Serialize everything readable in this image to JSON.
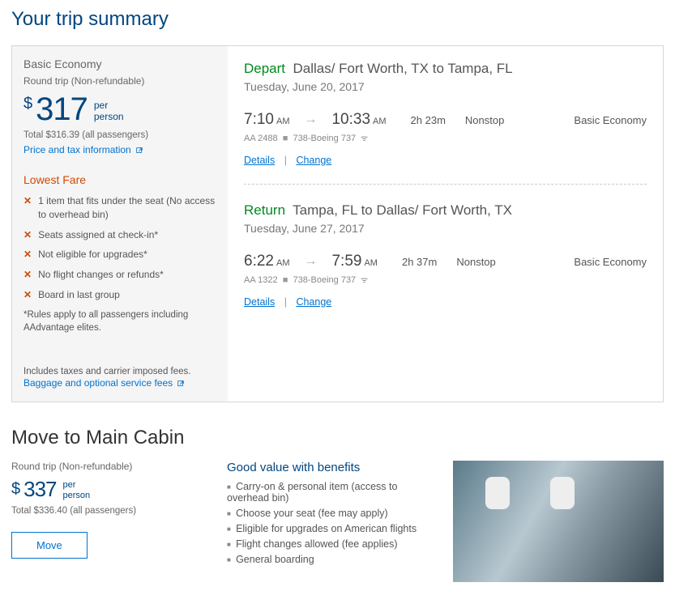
{
  "page_title": "Your trip summary",
  "summary": {
    "fare_class": "Basic Economy",
    "trip_type": "Round trip (Non-refundable)",
    "currency_symbol": "$",
    "price": "317",
    "per_label_1": "per",
    "per_label_2": "person",
    "total_line": "Total $316.39 (all passengers)",
    "price_tax_link": "Price and tax information",
    "lowest_fare_label": "Lowest Fare",
    "restrictions": [
      "1 item that fits under the seat (No access to overhead bin)",
      "Seats assigned at check-in*",
      "Not eligible for upgrades*",
      "No flight changes or refunds*",
      "Board in last group"
    ],
    "rules_note": "*Rules apply to all passengers including AAdvantage elites.",
    "includes_note": "Includes taxes and carrier imposed fees.",
    "baggage_link": "Baggage and optional service fees"
  },
  "segments": [
    {
      "label": "Depart",
      "route": "Dallas/ Fort Worth, TX to Tampa, FL",
      "date": "Tuesday, June 20, 2017",
      "dep_time": "7:10",
      "dep_ampm": "AM",
      "arr_time": "10:33",
      "arr_ampm": "AM",
      "duration": "2h  23m",
      "stops": "Nonstop",
      "fare": "Basic Economy",
      "flight_no": "AA 2488",
      "aircraft": "738-Boeing 737",
      "details_link": "Details",
      "change_link": "Change"
    },
    {
      "label": "Return",
      "route": "Tampa, FL to Dallas/ Fort Worth, TX",
      "date": "Tuesday, June 27, 2017",
      "dep_time": "6:22",
      "dep_ampm": "AM",
      "arr_time": "7:59",
      "arr_ampm": "AM",
      "duration": "2h  37m",
      "stops": "Nonstop",
      "fare": "Basic Economy",
      "flight_no": "AA 1322",
      "aircraft": "738-Boeing 737",
      "details_link": "Details",
      "change_link": "Change"
    }
  ],
  "move": {
    "title": "Move to Main Cabin",
    "trip_type": "Round trip (Non-refundable)",
    "currency_symbol": "$",
    "price": "337",
    "per_label_1": "per",
    "per_label_2": "person",
    "total_line": "Total $336.40 (all passengers)",
    "button": "Move",
    "benefits_title": "Good value with benefits",
    "benefits": [
      "Carry-on & personal item (access to overhead bin)",
      "Choose your seat (fee may apply)",
      "Eligible for upgrades on American flights",
      "Flight changes allowed (fee applies)",
      "General boarding"
    ]
  }
}
